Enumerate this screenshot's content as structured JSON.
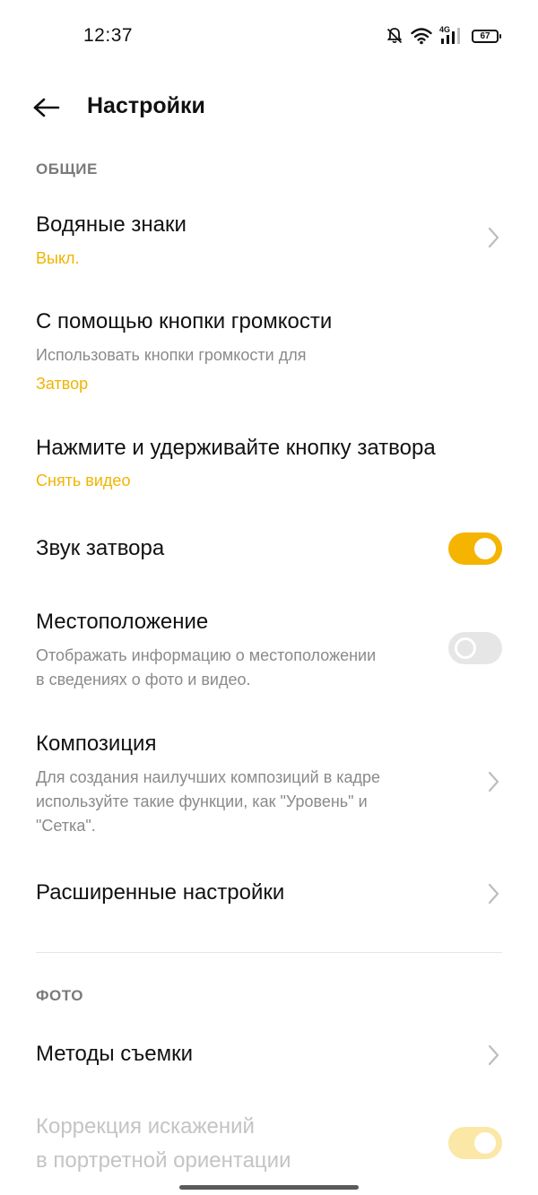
{
  "status_bar": {
    "time": "12:37",
    "battery": "67",
    "network": "4G",
    "icons": [
      "bell-off-icon",
      "wifi-icon",
      "signal-icon",
      "battery-icon"
    ]
  },
  "header": {
    "title": "Настройки",
    "back_icon": "arrow-left-icon"
  },
  "colors": {
    "accent": "#f5b400",
    "accent_text": "#f0b400",
    "section_label": "#7a7a7a",
    "secondary_text": "#8a8a8a"
  },
  "sections": {
    "general": {
      "label": "ОБЩИЕ",
      "watermark": {
        "title": "Водяные знаки",
        "value": "Выкл."
      },
      "volume_buttons": {
        "title": "С помощью кнопки громкости",
        "description": "Использовать кнопки громкости для",
        "value": "Затвор"
      },
      "shutter_hold": {
        "title": "Нажмите и удерживайте кнопку затвора",
        "value": "Снять видео"
      },
      "shutter_sound": {
        "title": "Звук затвора",
        "enabled": true
      },
      "location": {
        "title": "Местоположение",
        "description_line1": "Отображать информацию о местоположении",
        "description_line2": "в сведениях о фото и видео.",
        "enabled": false
      },
      "composition": {
        "title": "Композиция",
        "description_line1": "Для создания наилучших композиций в кадре",
        "description_line2": "используйте такие функции, как \"Уровень\" и",
        "description_line3": "\"Сетка\"."
      },
      "advanced": {
        "title": "Расширенные настройки"
      }
    },
    "photo": {
      "label": "ФОТО",
      "shooting_methods": {
        "title": "Методы съемки"
      },
      "distortion_correction": {
        "title_line1": "Коррекция искажений",
        "title_line2": "в портретной ориентации",
        "enabled": true,
        "disabled": true
      }
    }
  }
}
